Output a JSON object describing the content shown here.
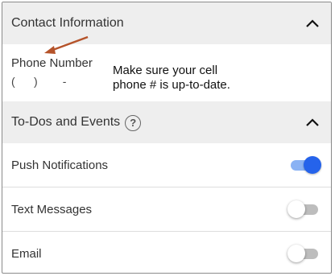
{
  "contact": {
    "title": "Contact Information",
    "phone_label": "Phone Number",
    "phone_value": "(      )        -",
    "note_line1": "Make sure your cell",
    "note_line2": "phone # is up-to-date."
  },
  "todos": {
    "title": "To-Dos and Events",
    "help_glyph": "?"
  },
  "settings": [
    {
      "label": "Push Notifications",
      "enabled": true
    },
    {
      "label": "Text Messages",
      "enabled": false
    },
    {
      "label": "Email",
      "enabled": false
    }
  ],
  "colors": {
    "accent": "#2563eb",
    "track_on": "#8ab2f4",
    "arrow": "#b5532a",
    "header_bg": "#eeeeee"
  },
  "icons": {
    "collapse": "chevron-up-icon",
    "help": "help-circle-icon",
    "annotation": "arrow-icon"
  }
}
